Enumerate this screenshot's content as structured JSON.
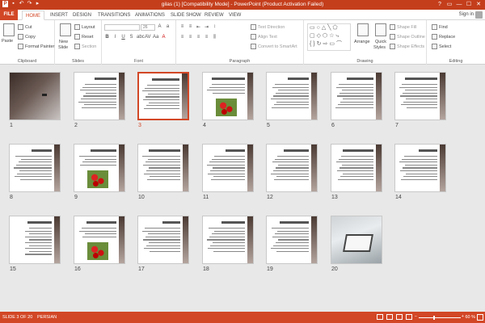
{
  "window": {
    "title": "gilas (1) [Compatibility Mode] - PowerPoint (Product Activation Failed)",
    "controls": [
      "?",
      "▭",
      "—",
      "☐",
      "✕"
    ]
  },
  "quick_access": [
    "save-icon",
    "undo-icon",
    "redo-icon",
    "present-icon"
  ],
  "tabs": [
    "FILE",
    "HOME",
    "INSERT",
    "DESIGN",
    "TRANSITIONS",
    "ANIMATIONS",
    "SLIDE SHOW",
    "REVIEW",
    "VIEW"
  ],
  "active_tab": "HOME",
  "account": {
    "sign_in": "Sign in"
  },
  "ribbon": {
    "clipboard": {
      "label": "Clipboard",
      "paste": "Paste",
      "cut": "Cut",
      "copy": "Copy",
      "format_painter": "Format Painter"
    },
    "slides": {
      "label": "Slides",
      "new_slide_1": "New",
      "new_slide_2": "Slide",
      "layout": "Layout",
      "reset": "Reset",
      "section": "Section"
    },
    "font": {
      "label": "Font",
      "font_name": "",
      "font_size": "26",
      "bold": "B",
      "italic": "I",
      "underline": "U",
      "strike": "S",
      "shadow": "abc",
      "spacing": "AV",
      "case": "Aa",
      "color": "A"
    },
    "paragraph": {
      "label": "Paragraph",
      "text_direction": "Text Direction",
      "align_text": "Align Text",
      "convert_smartart": "Convert to SmartArt"
    },
    "drawing": {
      "label": "Drawing",
      "arrange": "Arrange",
      "quick_styles_1": "Quick",
      "quick_styles_2": "Styles",
      "shape_fill": "Shape Fill",
      "shape_outline": "Shape Outline",
      "shape_effects": "Shape Effects"
    },
    "editing": {
      "label": "Editing",
      "find": "Find",
      "replace": "Replace",
      "select": "Select"
    }
  },
  "slides": [
    {
      "num": "1",
      "kind": "cover"
    },
    {
      "num": "2",
      "kind": "text"
    },
    {
      "num": "3",
      "kind": "text"
    },
    {
      "num": "4",
      "kind": "text-pic"
    },
    {
      "num": "5",
      "kind": "text"
    },
    {
      "num": "6",
      "kind": "text"
    },
    {
      "num": "7",
      "kind": "text"
    },
    {
      "num": "8",
      "kind": "text"
    },
    {
      "num": "9",
      "kind": "text-pic"
    },
    {
      "num": "10",
      "kind": "text"
    },
    {
      "num": "11",
      "kind": "text"
    },
    {
      "num": "12",
      "kind": "text"
    },
    {
      "num": "13",
      "kind": "text"
    },
    {
      "num": "14",
      "kind": "text"
    },
    {
      "num": "15",
      "kind": "list"
    },
    {
      "num": "16",
      "kind": "text-pic"
    },
    {
      "num": "17",
      "kind": "text"
    },
    {
      "num": "18",
      "kind": "text"
    },
    {
      "num": "19",
      "kind": "text"
    },
    {
      "num": "20",
      "kind": "photo"
    }
  ],
  "selected_slide": "3",
  "status": {
    "slide_info": "SLIDE 3 OF 20",
    "language": "PERSIAN",
    "zoom": "60 %",
    "zoom_minus": "−",
    "zoom_plus": "+"
  },
  "colors": {
    "accent": "#d24726",
    "title_bar": "#c43e1c",
    "status_bar": "#d24726"
  }
}
